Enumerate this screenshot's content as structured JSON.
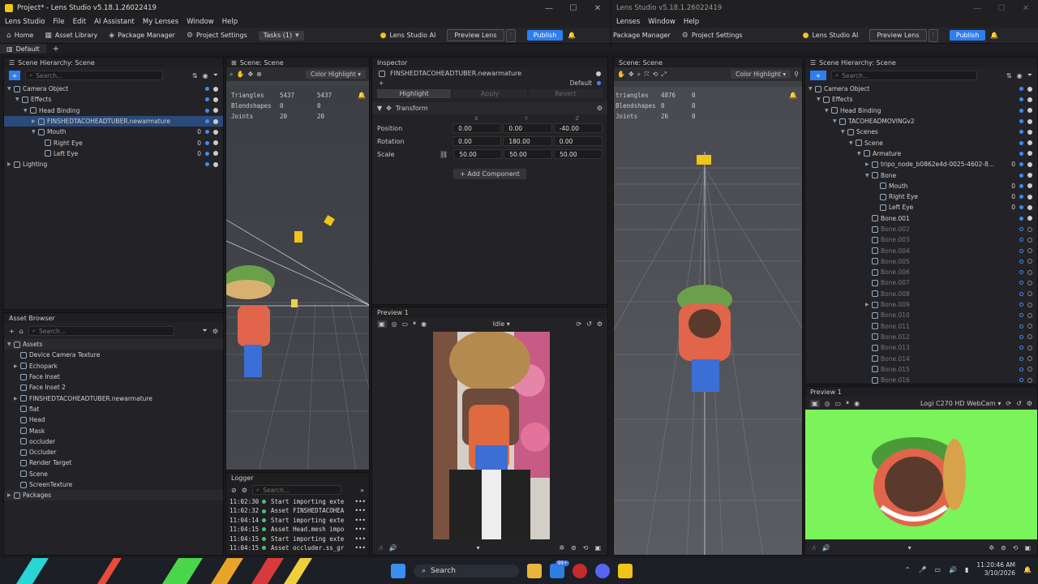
{
  "left": {
    "title": "Project* - Lens Studio v5.18.1.26022419",
    "menu": [
      "Lens Studio",
      "File",
      "Edit",
      "AI Assistant",
      "My Lenses",
      "Window",
      "Help"
    ],
    "toolbar": {
      "home": "Home",
      "asset_library": "Asset Library",
      "package_manager": "Package Manager",
      "project_settings": "Project Settings",
      "tasks": "Tasks (1)",
      "lens_ai": "Lens Studio AI",
      "preview_lens": "Preview Lens",
      "publish": "Publish"
    },
    "layout_tab": "Default",
    "hierarchy": {
      "title": "Scene Hierarchy: Scene",
      "search": "Search...",
      "items": [
        {
          "label": "Camera Object",
          "zero": ""
        },
        {
          "label": "Effects",
          "zero": ""
        },
        {
          "label": "Head Binding",
          "zero": ""
        },
        {
          "label": "FINSHEDTACOHEADTUBER.newarmature",
          "zero": ""
        },
        {
          "label": "Mouth",
          "zero": "0"
        },
        {
          "label": "Right Eye",
          "zero": "0"
        },
        {
          "label": "Left Eye",
          "zero": "0"
        },
        {
          "label": "Lighting",
          "zero": ""
        }
      ]
    },
    "assets": {
      "title": "Asset Browser",
      "search": "Search...",
      "items": [
        "Assets",
        "Device Camera Texture",
        "Echopark",
        "Face Inset",
        "Face Inset 2",
        "FINSHEDTACOHEADTUBER.newarmature",
        "flat",
        "Head",
        "Mask",
        "occluder",
        "Occluder",
        "Render Target",
        "Scene",
        "ScreenTexture",
        "Packages"
      ]
    },
    "scene": {
      "title": "Scene: Scene",
      "color_mode": "Color Highlight",
      "stats": [
        [
          "Triangles",
          "5437",
          "5437"
        ],
        [
          "Blendshapes",
          "0",
          "0"
        ],
        [
          "Joints",
          "20",
          "20"
        ]
      ]
    },
    "logger": {
      "title": "Logger",
      "search": "Search...",
      "lines": [
        [
          "11:02:30",
          "Start importing exte"
        ],
        [
          "11:02:32",
          "Asset FINSHEDTACOHEA"
        ],
        [
          "11:04:14",
          "Start importing exte"
        ],
        [
          "11:04:15",
          "Asset Head.mesh impo"
        ],
        [
          "11:04:15",
          "Start importing exte"
        ],
        [
          "11:04:15",
          "Asset occluder.ss_gr"
        ]
      ]
    },
    "inspector": {
      "title": "Inspector",
      "object": "FINSHEDTACOHEADTUBER.newarmature",
      "layer": "Default",
      "highlight": "Highlight",
      "apply": "Apply",
      "revert": "Revert",
      "transform": "Transform",
      "axes": [
        "X",
        "Y",
        "Z"
      ],
      "rows": [
        {
          "label": "Position",
          "x": "0.00",
          "y": "0.00",
          "z": "-40.00"
        },
        {
          "label": "Rotation",
          "x": "0.00",
          "y": "180.00",
          "z": "0.00"
        },
        {
          "label": "Scale",
          "x": "50.00",
          "y": "50.00",
          "z": "50.00"
        }
      ],
      "add_component": "Add Component"
    },
    "preview": {
      "title": "Preview 1",
      "state": "Idle"
    }
  },
  "right": {
    "title": "Lens Studio v5.18.1.26022419",
    "menu": [
      "Lenses",
      "Window",
      "Help"
    ],
    "toolbar": {
      "package_manager": "Package Manager",
      "project_settings": "Project Settings",
      "lens_ai": "Lens Studio AI",
      "preview_lens": "Preview Lens",
      "publish": "Publish"
    },
    "scene": {
      "title": "Scene: Scene",
      "color_mode": "Color Highlight",
      "stats": [
        [
          "triangles",
          "4876",
          "0"
        ],
        [
          "Blendshapes",
          "0",
          "0"
        ],
        [
          "Joints",
          "26",
          "0"
        ]
      ]
    },
    "hierarchy": {
      "title": "Scene Hierarchy: Scene",
      "search": "Search...",
      "items": [
        {
          "label": "Camera Object",
          "zero": ""
        },
        {
          "label": "Effects",
          "zero": ""
        },
        {
          "label": "Head Binding",
          "zero": ""
        },
        {
          "label": "TACOHEADMOVINGv2",
          "zero": ""
        },
        {
          "label": "Scenes",
          "zero": ""
        },
        {
          "label": "Scene",
          "zero": ""
        },
        {
          "label": "Armature",
          "zero": ""
        },
        {
          "label": "tripo_node_b0862e4d-0025-4602-8...",
          "zero": "0"
        },
        {
          "label": "Bone",
          "zero": ""
        },
        {
          "label": "Mouth",
          "zero": "0"
        },
        {
          "label": "Right Eye",
          "zero": "0"
        },
        {
          "label": "Left Eye",
          "zero": "0"
        },
        {
          "label": "Bone.001",
          "zero": ""
        },
        {
          "label": "Bone.002",
          "zero": ""
        },
        {
          "label": "Bone.003",
          "zero": ""
        },
        {
          "label": "Bone.004",
          "zero": ""
        },
        {
          "label": "Bone.005",
          "zero": ""
        },
        {
          "label": "Bone.006",
          "zero": ""
        },
        {
          "label": "Bone.007",
          "zero": ""
        },
        {
          "label": "Bone.008",
          "zero": ""
        },
        {
          "label": "Bone.009",
          "zero": ""
        },
        {
          "label": "Bone.010",
          "zero": ""
        },
        {
          "label": "Bone.011",
          "zero": ""
        },
        {
          "label": "Bone.012",
          "zero": ""
        },
        {
          "label": "Bone.013",
          "zero": ""
        },
        {
          "label": "Bone.014",
          "zero": ""
        },
        {
          "label": "Bone.015",
          "zero": ""
        },
        {
          "label": "Bone.016",
          "zero": ""
        }
      ]
    },
    "preview": {
      "title": "Preview 1",
      "camera": "Logi C270 HD WebCam"
    }
  },
  "taskbar": {
    "search": "Search",
    "time": "11:20:46 AM",
    "date": "3/10/2026",
    "badge": "99+"
  },
  "colors": {
    "accent": "#2d7ff0",
    "selection": "#2b4a7a",
    "green_screen": "#7bf35a"
  }
}
